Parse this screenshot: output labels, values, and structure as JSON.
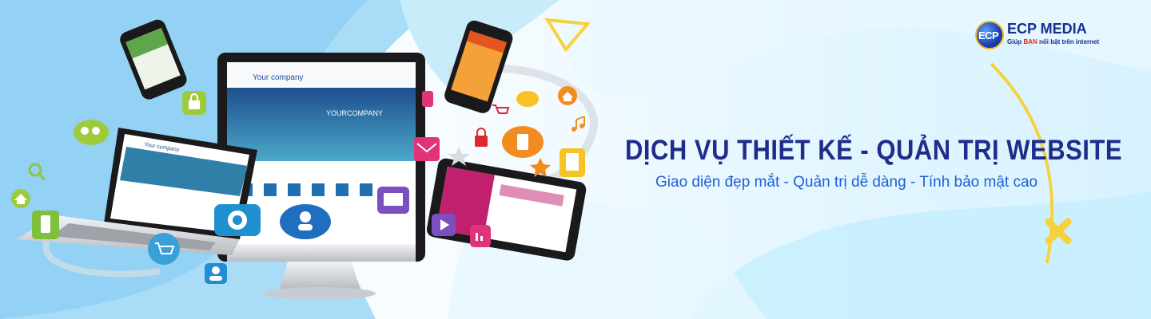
{
  "brand": {
    "mark_text": "ECP",
    "name": "ECP MEDIA",
    "tagline_prefix": "Giúp ",
    "tagline_highlight": "BẠN",
    "tagline_suffix": " nổi bật trên internet"
  },
  "headline": "DỊCH VỤ THIẾT KẾ - QUẢN TRỊ WEBSITE",
  "subline": "Giao diện đẹp mắt - Quản trị dễ dàng - Tính bảo mật cao",
  "screen_texts": {
    "laptop_brand": "Your company",
    "monitor_brand": "Your company",
    "monitor_hero": "YOURCOMPANY"
  },
  "colors": {
    "headline": "#1f2d8a",
    "subline": "#1e5fd8",
    "brand_blue": "#1a2d8f",
    "brand_red": "#e0261a",
    "accent_yellow": "#f6d23a",
    "bg_blue": "#8fd0f3"
  },
  "icons": [
    "lock-icon",
    "users-icon",
    "search-icon",
    "home-icon",
    "phone-icon",
    "cart-icon",
    "cloud-icon",
    "mail-icon",
    "star-icon",
    "play-icon",
    "chart-icon",
    "music-icon",
    "globe-icon",
    "chat-icon",
    "user-icon",
    "calculator-icon"
  ]
}
